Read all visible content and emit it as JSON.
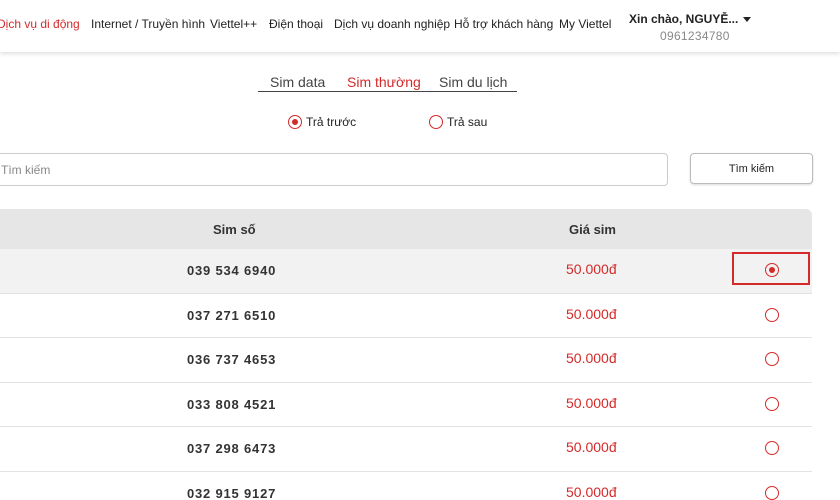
{
  "nav": {
    "items": [
      {
        "label": "Dịch vụ di động",
        "active": true
      },
      {
        "label": "Internet / Truyền hình",
        "active": false
      },
      {
        "label": "Viettel++",
        "active": false
      },
      {
        "label": "Điện thoại",
        "active": false
      },
      {
        "label": "Dịch vụ doanh nghiệp",
        "active": false
      },
      {
        "label": "Hỗ trợ khách hàng",
        "active": false
      },
      {
        "label": "My Viettel",
        "active": false
      }
    ],
    "user": {
      "greeting": "Xin chào, NGUYỄ...",
      "phone": "0961234780"
    }
  },
  "sim_tabs": {
    "items": [
      "Sim data",
      "Sim thường",
      "Sim du lịch"
    ],
    "active_index": 1
  },
  "payment": {
    "options": [
      "Trả trước",
      "Trả sau"
    ],
    "selected_index": 0
  },
  "search": {
    "placeholder": "Tìm kiếm",
    "button_label": "Tìm kiếm"
  },
  "table": {
    "headers": [
      "Sim số",
      "Giá sim"
    ],
    "rows": [
      {
        "number": "039 534 6940",
        "price": "50.000đ",
        "selected": true
      },
      {
        "number": "037 271 6510",
        "price": "50.000đ",
        "selected": false
      },
      {
        "number": "036 737 4653",
        "price": "50.000đ",
        "selected": false
      },
      {
        "number": "033 808 4521",
        "price": "50.000đ",
        "selected": false
      },
      {
        "number": "037 298 6473",
        "price": "50.000đ",
        "selected": false
      },
      {
        "number": "032 915 9127",
        "price": "50.000đ",
        "selected": false
      }
    ]
  },
  "colors": {
    "accent": "#d42a2a",
    "header_bg": "#e6e6e6",
    "selected_row_bg": "#f2f2f2"
  }
}
